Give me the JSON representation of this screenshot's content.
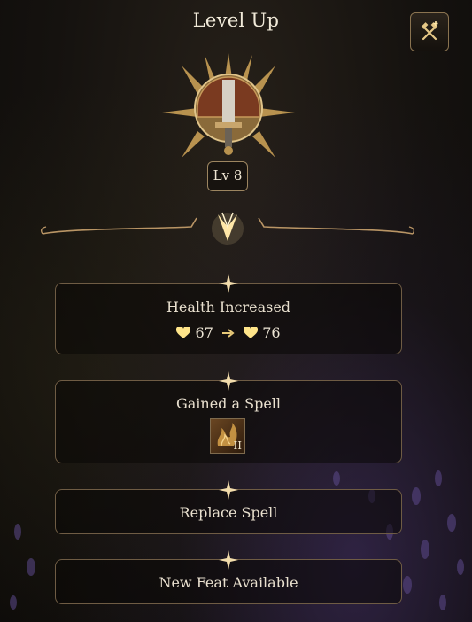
{
  "header": {
    "title": "Level Up",
    "tool_icon": "tools-icon"
  },
  "emblem": {
    "icon": "class-emblem-icon",
    "level_label": "Lv 8"
  },
  "cards": {
    "health": {
      "title": "Health Increased",
      "from": "67",
      "to": "76",
      "icon": "heart-icon"
    },
    "spell": {
      "title": "Gained a Spell",
      "spell_level": "II",
      "icon": "spell-icon"
    },
    "replace": {
      "title": "Replace Spell"
    },
    "feat": {
      "title": "New Feat Available"
    }
  },
  "colors": {
    "gold": "#d9b36a",
    "bright_gold": "#ffe3a0",
    "frame": "#6f5c44",
    "text": "#e9e0cf"
  }
}
